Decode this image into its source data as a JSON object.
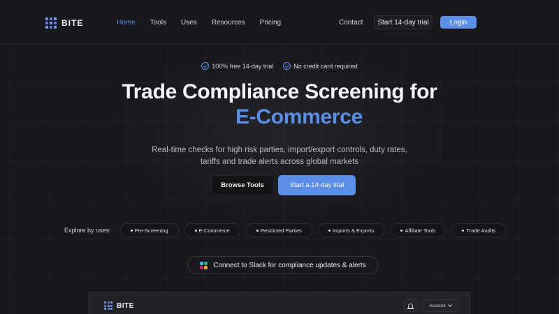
{
  "nav": {
    "brand": "BITE",
    "links": [
      "Home",
      "Tools",
      "Uses",
      "Resources",
      "Pricing"
    ],
    "contact": "Contact",
    "trial_button": "Start 14-day trial",
    "login_button": "Login"
  },
  "badges": [
    "100% free 14-day trial",
    "No credit card required"
  ],
  "hero": {
    "title": "Trade Compliance Screening for",
    "title_accent": "E-Commerce",
    "subtitle_line1": "Real-time checks for high risk parties, import/export controls, duty rates,",
    "subtitle_line2": "tariffs and trade alerts across global markets"
  },
  "cta": {
    "browse": "Browse Tools",
    "trial": "Start a 14-day trial"
  },
  "explore": {
    "label": "Explore by uses:",
    "pills": [
      "Pre-Screening",
      "E-Commerce",
      "Restricted Parties",
      "Imports & Exports",
      "Affiliate Tools",
      "Trade Audits"
    ]
  },
  "slack": {
    "text": "Connect to Slack for compliance updates & alerts"
  },
  "preview": {
    "brand": "BITE",
    "account": "Account"
  },
  "colors": {
    "accent": "#5b8ee8",
    "background": "#17181b"
  }
}
